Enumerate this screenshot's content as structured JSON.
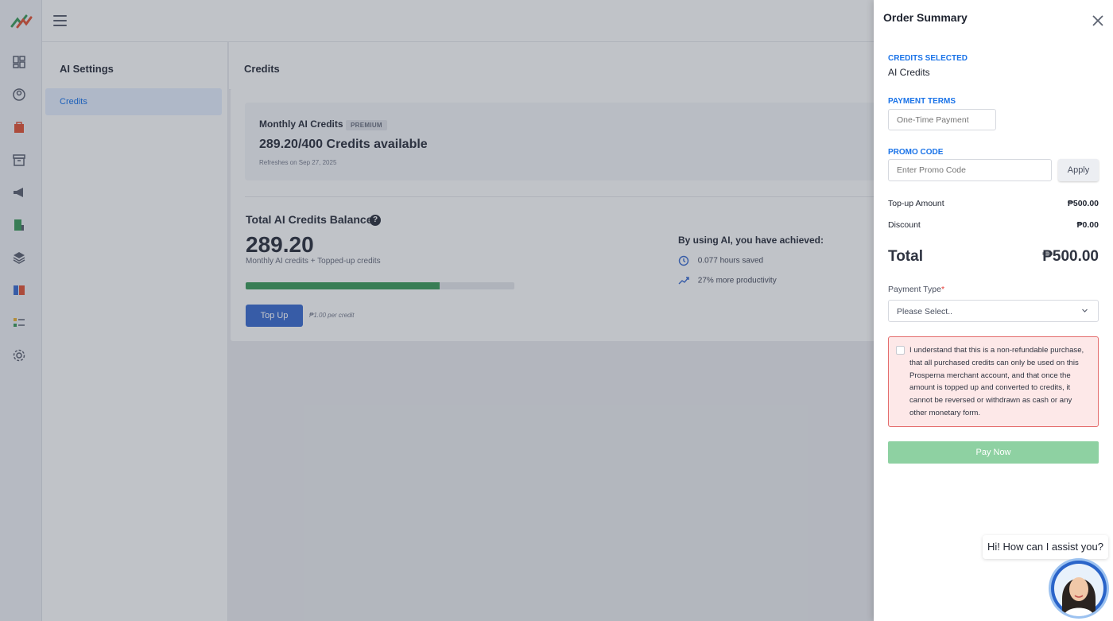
{
  "settings_nav": {
    "title": "AI Settings",
    "items": [
      {
        "label": "Credits"
      }
    ]
  },
  "main": {
    "header_title": "Credits",
    "monthly": {
      "title": "Monthly AI Credits",
      "badge": "PREMIUM",
      "available": "289.20/400 Credits available",
      "refresh": "Refreshes on Sep 27, 2025"
    },
    "balance": {
      "title": "Total AI Credits Balance",
      "value": "289.20",
      "subtitle": "Monthly AI credits + Topped-up credits",
      "progress": 0.723,
      "topup_label": "Top Up",
      "per_credit": "₱1.00 per credit"
    },
    "achievements": {
      "title": "By using AI, you have achieved:",
      "items": [
        {
          "icon": "clock-icon",
          "text": "0.077 hours saved"
        },
        {
          "icon": "trending-up-icon",
          "text": "27% more productivity"
        }
      ]
    }
  },
  "drawer": {
    "title": "Order Summary",
    "credits_selected_label": "CREDITS SELECTED",
    "credits_selected_value": "AI Credits",
    "payment_terms_label": "PAYMENT TERMS",
    "payment_terms_value": "One-Time Payment",
    "promo_label": "PROMO CODE",
    "promo_placeholder": "Enter Promo Code",
    "apply_label": "Apply",
    "topup_amount_label": "Top-up Amount",
    "topup_amount_value": "₱500.00",
    "discount_label": "Discount",
    "discount_value": "₱0.00",
    "total_label": "Total",
    "total_value": "₱500.00",
    "payment_type_label": "Payment Type",
    "payment_type_required": "*",
    "payment_type_value": "Please Select..",
    "terms_text": "I understand that this is a non-refundable purchase, that all purchased credits can only be used on this Prosperna merchant account, and that once the amount is topped up and converted to credits, it cannot be reversed or withdrawn as cash or any other monetary form.",
    "pay_label": "Pay Now"
  },
  "assistant": {
    "message": "Hi! How can I assist you?"
  },
  "colors": {
    "accent": "#1a73e8",
    "progress": "#3f9b5e",
    "pay": "#8ed1a2",
    "terms_bg": "#fde8e8",
    "terms_border": "#e46d6d"
  }
}
